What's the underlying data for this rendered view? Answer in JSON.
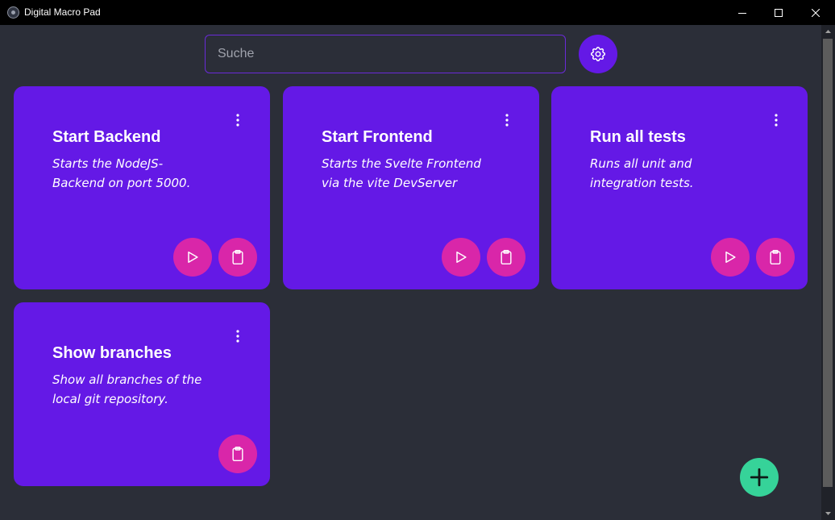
{
  "window": {
    "title": "Digital Macro Pad"
  },
  "search": {
    "placeholder": "Suche"
  },
  "colors": {
    "background": "#2b2e38",
    "card": "#6419e6",
    "action_button": "#d926a9",
    "add_button": "#36d399"
  },
  "icons": {
    "settings": "gear-icon",
    "run": "play-icon",
    "copy": "clipboard-icon",
    "menu": "kebab-menu-icon",
    "add": "plus-icon"
  },
  "macros": [
    {
      "title": "Start Backend",
      "description": "Starts the NodeJS-Backend on port 5000.",
      "has_run": true
    },
    {
      "title": "Start Frontend",
      "description": "Starts the Svelte Frontend via the vite DevServer",
      "has_run": true
    },
    {
      "title": "Run all tests",
      "description": "Runs all unit and integration tests.",
      "has_run": true
    },
    {
      "title": "Show branches",
      "description": "Show all branches of the local git repository.",
      "has_run": false
    }
  ]
}
